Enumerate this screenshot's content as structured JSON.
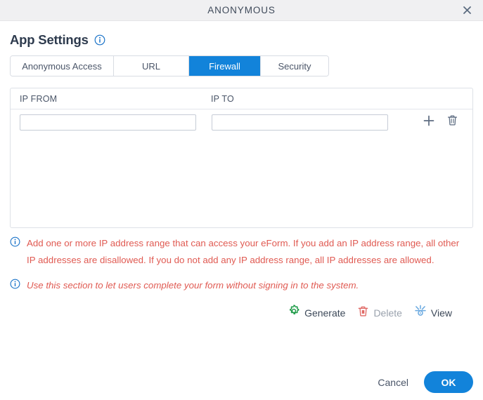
{
  "window": {
    "title": "ANONYMOUS",
    "close_icon": "close-icon"
  },
  "page": {
    "heading": "App Settings",
    "heading_info_icon": "info-icon"
  },
  "tabs": [
    {
      "label": "Anonymous Access",
      "active": false
    },
    {
      "label": "URL",
      "active": false
    },
    {
      "label": "Firewall",
      "active": true
    },
    {
      "label": "Security",
      "active": false
    }
  ],
  "table": {
    "columns": [
      "IP FROM",
      "IP TO"
    ],
    "rows": [
      {
        "ip_from": "",
        "ip_to": "",
        "ip_from_placeholder": "",
        "ip_to_placeholder": "",
        "add_icon": "plus-icon",
        "delete_icon": "trash-icon"
      }
    ]
  },
  "help": {
    "primary": "Add one or more IP address range that can access your eForm. If you add an IP address range, all other IP addresses are disallowed. If you do not add any IP address range, all IP addresses are allowed.",
    "secondary": "Use this section to let users complete your form without signing in to the system."
  },
  "actions": [
    {
      "label": "Generate",
      "icon": "gear-icon",
      "disabled": false
    },
    {
      "label": "Delete",
      "icon": "trash-icon",
      "disabled": true
    },
    {
      "label": "View",
      "icon": "view-icon",
      "disabled": false
    }
  ],
  "footer": {
    "cancel_label": "Cancel",
    "ok_label": "OK"
  },
  "colors": {
    "accent_blue": "#1283da",
    "info_blue": "#1a73c8",
    "help_red": "#e05a52",
    "gear_green": "#1a9944",
    "trash_red": "#e06a66",
    "view_blue": "#6aa9e0",
    "icon_grey": "#5c6b80",
    "disabled_grey": "#9aa2ad",
    "titlebar_bg": "#f0f0f2"
  }
}
